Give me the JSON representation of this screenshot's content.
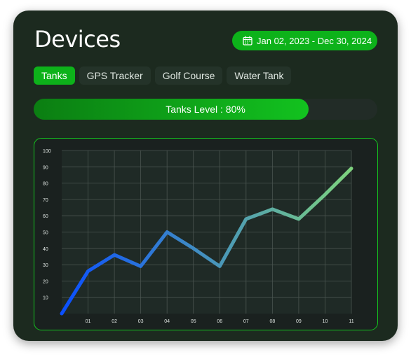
{
  "header": {
    "title": "Devices",
    "date_range": "Jan 02, 2023 - Dec 30, 2024"
  },
  "icons": {
    "date": "calendar-icon"
  },
  "colors": {
    "accent": "#0db21a",
    "card": "#1c2a1f",
    "line_start": "#0a4fff",
    "line_end": "#7ed37e"
  },
  "tabs": [
    {
      "label": "Tanks",
      "active": true
    },
    {
      "label": "GPS Tracker",
      "active": false
    },
    {
      "label": "Golf Course",
      "active": false
    },
    {
      "label": "Water Tank",
      "active": false
    }
  ],
  "tank_level": {
    "label": "Tanks Level : 80%",
    "percent": 80
  },
  "chart_data": {
    "type": "line",
    "title": "",
    "xlabel": "",
    "ylabel": "",
    "x_ticks": [
      "01",
      "02",
      "03",
      "04",
      "05",
      "06",
      "07",
      "08",
      "09",
      "10",
      "11"
    ],
    "y_ticks": [
      "10",
      "20",
      "30",
      "40",
      "50",
      "60",
      "70",
      "80",
      "90",
      "100"
    ],
    "ylim": [
      0,
      100
    ],
    "grid": true,
    "series": [
      {
        "x": [
          0,
          1,
          2,
          3,
          4,
          5,
          6,
          7,
          8,
          9,
          10,
          11
        ],
        "values": [
          0,
          26,
          36,
          29,
          50,
          40,
          29,
          58,
          64,
          58,
          73,
          89
        ]
      }
    ]
  }
}
